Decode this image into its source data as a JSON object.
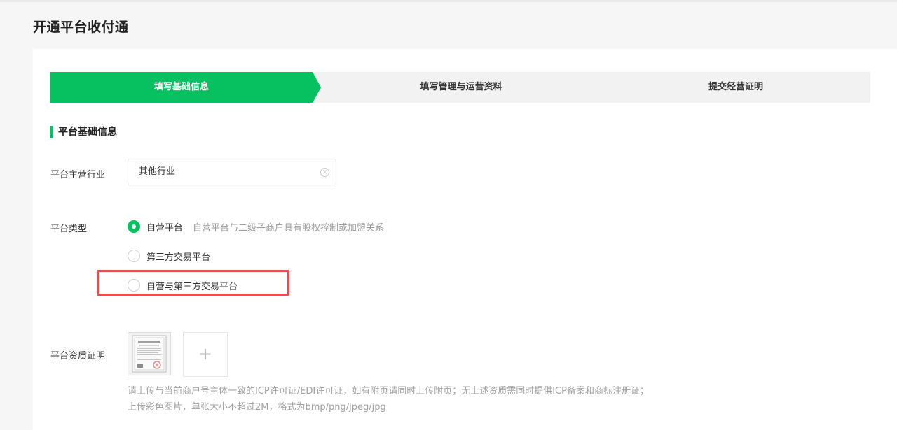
{
  "page": {
    "title": "开通平台收付通"
  },
  "steps": [
    {
      "label": "填写基础信息",
      "active": true
    },
    {
      "label": "填写管理与运营资料",
      "active": false
    },
    {
      "label": "提交经营证明",
      "active": false
    }
  ],
  "section": {
    "title": "平台基础信息"
  },
  "industry": {
    "label": "平台主营行业",
    "value": "其他行业",
    "clear_icon": "clear-circle-icon"
  },
  "platform_type": {
    "label": "平台类型",
    "options": [
      {
        "label": "自营平台",
        "description": "自营平台与二级子商户具有股权控制或加盟关系",
        "selected": true
      },
      {
        "label": "第三方交易平台",
        "selected": false
      },
      {
        "label": "自营与第三方交易平台",
        "selected": false
      }
    ]
  },
  "qualification": {
    "label": "平台资质证明",
    "upload_symbol": "+",
    "hint_line1": "请上传与当前商户号主体一致的ICP许可证/EDI许可证，如有附页请同时上传附页；无上述资质需同时提供ICP备案和商标注册证；",
    "hint_line2": "上传彩色图片，单张大小不超过2M，格式为bmp/png/jpeg/jpg"
  },
  "colors": {
    "accent": "#07c160",
    "highlight": "#e15353"
  }
}
